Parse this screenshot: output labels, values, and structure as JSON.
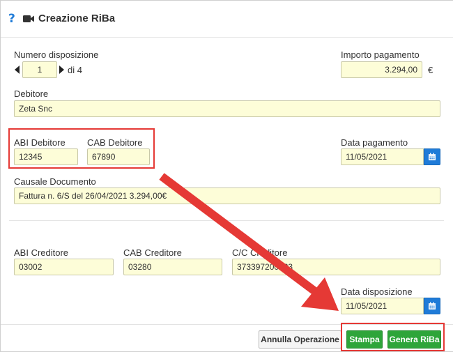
{
  "header": {
    "title": "Creazione RiBa",
    "help_icon": "?"
  },
  "numero_disposizione": {
    "label": "Numero disposizione",
    "value": "1",
    "of_text": "di 4"
  },
  "importo": {
    "label": "Importo pagamento",
    "value": "3.294,00",
    "currency": "€"
  },
  "debitore": {
    "label": "Debitore",
    "value": "Zeta Snc"
  },
  "abi_debitore": {
    "label": "ABI Debitore",
    "value": "12345"
  },
  "cab_debitore": {
    "label": "CAB Debitore",
    "value": "67890"
  },
  "data_pagamento": {
    "label": "Data pagamento",
    "value": "11/05/2021"
  },
  "causale": {
    "label": "Causale Documento",
    "value": "Fattura n. 6/S del 26/04/2021 3.294,00€"
  },
  "abi_creditore": {
    "label": "ABI Creditore",
    "value": "03002"
  },
  "cab_creditore": {
    "label": "CAB Creditore",
    "value": "03280"
  },
  "cc_creditore": {
    "label": "C/C Creditore",
    "value": "373397200333"
  },
  "data_disposizione": {
    "label": "Data disposizione",
    "value": "11/05/2021"
  },
  "footer": {
    "cancel_label": "Annulla Operazione",
    "print_label": "Stampa",
    "generate_label": "Genera RiBa"
  },
  "colors": {
    "accent": "#1f7bd8",
    "field_bg": "#fdfdd8",
    "button_green": "#2ea53a",
    "highlight": "#e53935"
  },
  "icons": [
    "help-icon",
    "video-camera-icon",
    "caret-left-icon",
    "caret-right-icon",
    "calendar-icon"
  ]
}
